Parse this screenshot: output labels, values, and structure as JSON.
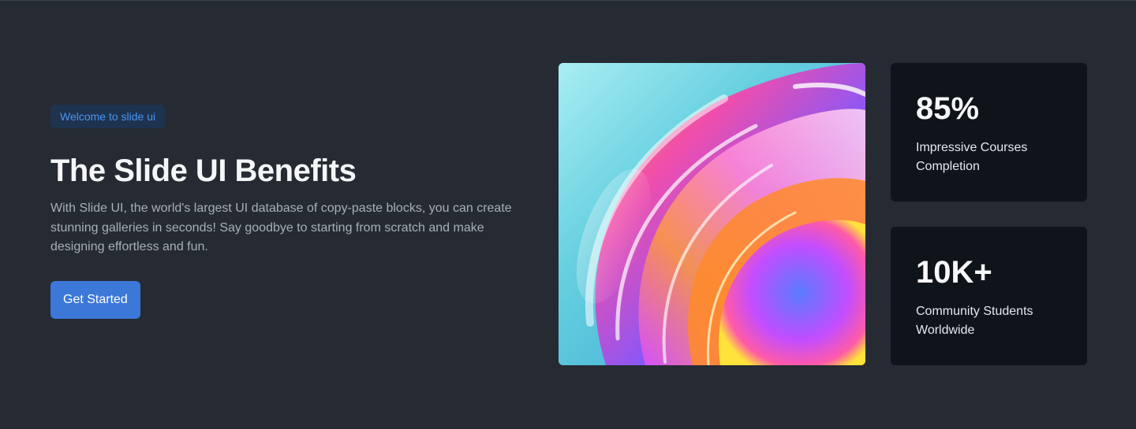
{
  "hero": {
    "badge": "Welcome to slide ui",
    "title": "The Slide UI Benefits",
    "description": "With Slide UI, the world's largest UI database of copy-paste blocks, you can create stunning galleries in seconds! Say goodbye to starting from scratch and make designing effortless and fun.",
    "cta_label": "Get Started"
  },
  "stats": [
    {
      "value": "85%",
      "label": "Impressive Courses Completion"
    },
    {
      "value": "10K+",
      "label": "Community Students Worldwide"
    }
  ],
  "colors": {
    "background": "#262b33",
    "accent": "#3b78d8",
    "badge_text": "#4a94ee",
    "card": "#0f131a"
  },
  "image": {
    "icon": "abstract-glass-swirl-image"
  }
}
